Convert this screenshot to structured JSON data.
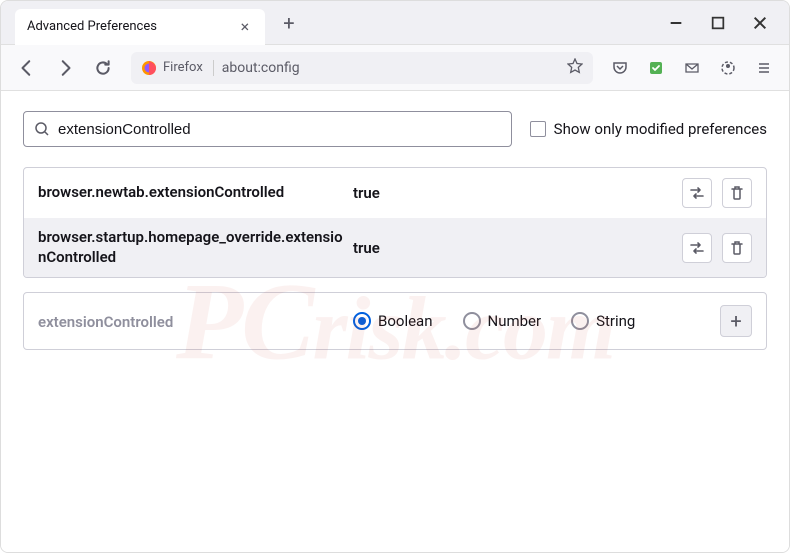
{
  "tab": {
    "title": "Advanced Preferences"
  },
  "urlbar": {
    "identity": "Firefox",
    "url": "about:config"
  },
  "search": {
    "value": "extensionControlled",
    "checkbox_label": "Show only modified preferences"
  },
  "prefs": [
    {
      "name": "browser.newtab.extensionControlled",
      "value": "true"
    },
    {
      "name": "browser.startup.homepage_override.extensionControlled",
      "value": "true"
    }
  ],
  "newpref": {
    "name": "extensionControlled",
    "types": [
      "Boolean",
      "Number",
      "String"
    ],
    "selected": "Boolean"
  },
  "watermark": {
    "pc": "PC",
    "rest": "risk.com"
  }
}
